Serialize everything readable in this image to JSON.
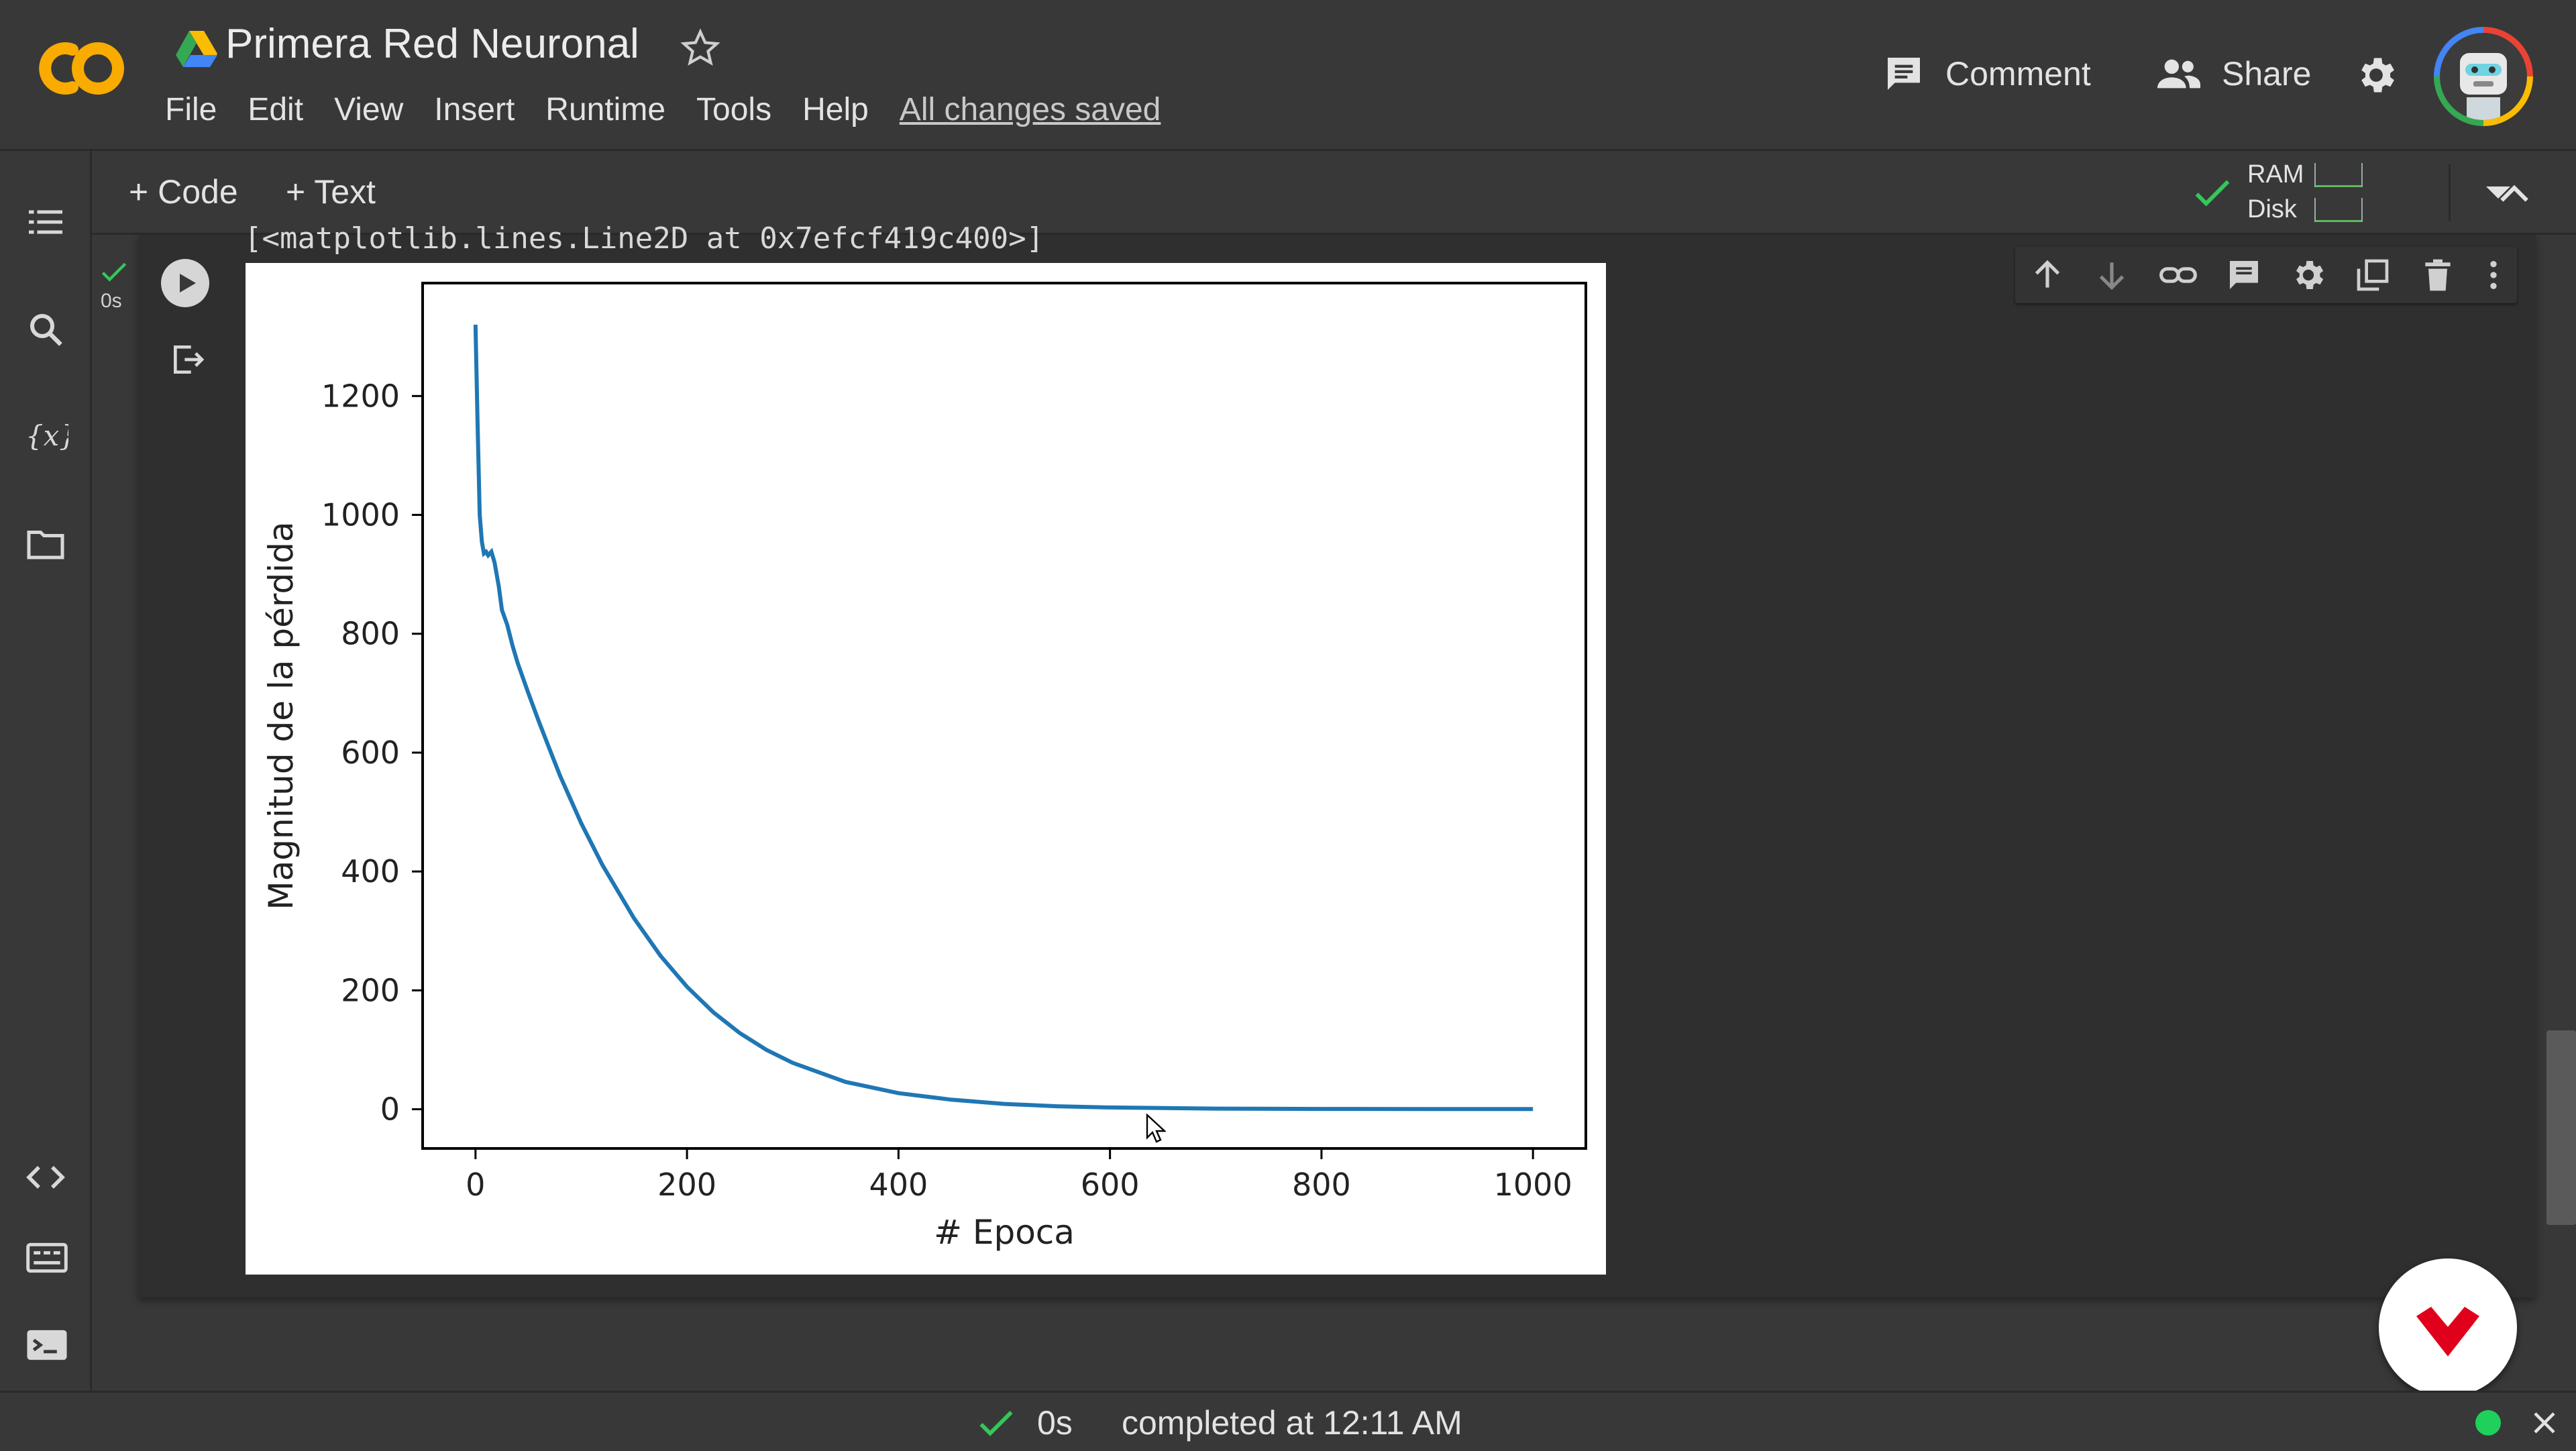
{
  "app": {
    "logo_text": "CO",
    "doc_title": "Primera Red Neuronal",
    "menu": [
      "File",
      "Edit",
      "View",
      "Insert",
      "Runtime",
      "Tools",
      "Help"
    ],
    "save_status": "All changes saved",
    "comment_label": "Comment",
    "share_label": "Share"
  },
  "toolbar": {
    "add_code_label": "+ Code",
    "add_text_label": "+ Text",
    "ram_label": "RAM",
    "disk_label": "Disk"
  },
  "cell": {
    "exec_time": "0s",
    "output_text": "[<matplotlib.lines.Line2D at 0x7efcf419c400>]"
  },
  "status": {
    "time": "0s",
    "text": "completed at 12:11 AM"
  },
  "icons": {
    "left_rail": [
      "toc-icon",
      "search-icon",
      "variables-icon",
      "folder-icon",
      "code-snippets-icon",
      "command-palette-icon",
      "terminal-icon"
    ],
    "cell_tools": [
      "move-up-icon",
      "move-down-icon",
      "link-icon",
      "comment-icon",
      "settings-icon",
      "mirror-cell-icon",
      "delete-icon",
      "more-icon"
    ]
  },
  "colors": {
    "accent_orange": "#f9ab00",
    "line_blue": "#1f77b4",
    "status_green": "#1fd15a"
  },
  "chart_data": {
    "type": "line",
    "title": "",
    "xlabel": "# Epoca",
    "ylabel": "Magnitud de la pérdida",
    "xlim": [
      -50,
      1050
    ],
    "ylim": [
      -66,
      1390
    ],
    "xticks": [
      0,
      200,
      400,
      600,
      800,
      1000
    ],
    "yticks": [
      0,
      200,
      400,
      600,
      800,
      1000,
      1200
    ],
    "grid": false,
    "legend": "none",
    "series": [
      {
        "x": [
          0,
          2,
          4,
          6,
          8,
          10,
          12,
          15,
          18,
          22,
          25,
          30,
          35,
          40,
          50,
          60,
          70,
          80,
          100,
          120,
          150,
          175,
          200,
          225,
          250,
          275,
          300,
          350,
          400,
          450,
          500,
          550,
          600,
          650,
          700,
          800,
          900,
          1000
        ],
        "y": [
          1320,
          1150,
          1000,
          955,
          935,
          938,
          932,
          938,
          920,
          880,
          840,
          815,
          780,
          750,
          700,
          652,
          606,
          561,
          481,
          411,
          321,
          258,
          206,
          163,
          128,
          100,
          78,
          46,
          27,
          16,
          9,
          5,
          3,
          2,
          1,
          0.5,
          0.3,
          0.2
        ]
      }
    ]
  }
}
